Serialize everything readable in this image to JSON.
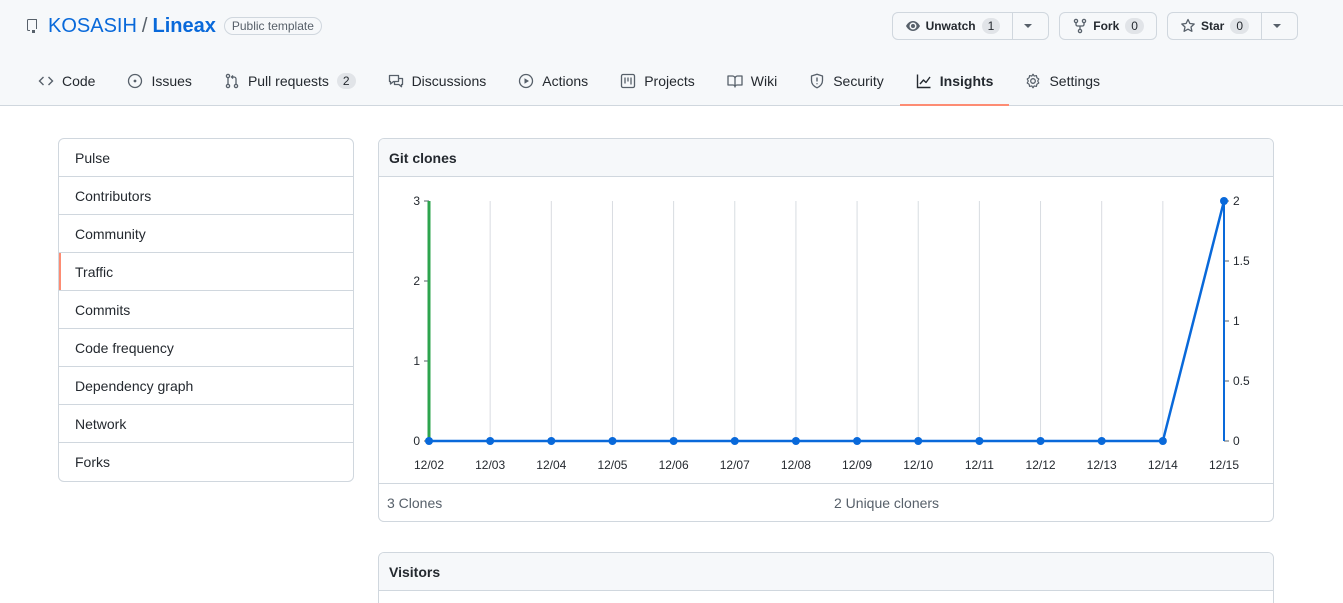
{
  "repo": {
    "owner": "KOSASIH",
    "separator": "/",
    "name": "Lineax",
    "visibility": "Public template"
  },
  "actions": {
    "watch": {
      "label": "Unwatch",
      "count": "1"
    },
    "fork": {
      "label": "Fork",
      "count": "0"
    },
    "star": {
      "label": "Star",
      "count": "0"
    }
  },
  "tabs": [
    {
      "label": "Code",
      "icon": "code-icon"
    },
    {
      "label": "Issues",
      "icon": "issue-icon"
    },
    {
      "label": "Pull requests",
      "icon": "pull-request-icon",
      "count": "2"
    },
    {
      "label": "Discussions",
      "icon": "discussion-icon"
    },
    {
      "label": "Actions",
      "icon": "play-icon"
    },
    {
      "label": "Projects",
      "icon": "project-icon"
    },
    {
      "label": "Wiki",
      "icon": "book-icon"
    },
    {
      "label": "Security",
      "icon": "shield-icon"
    },
    {
      "label": "Insights",
      "icon": "graph-icon",
      "active": true
    },
    {
      "label": "Settings",
      "icon": "gear-icon"
    }
  ],
  "menu": [
    {
      "label": "Pulse"
    },
    {
      "label": "Contributors"
    },
    {
      "label": "Community"
    },
    {
      "label": "Traffic",
      "selected": true
    },
    {
      "label": "Commits"
    },
    {
      "label": "Code frequency"
    },
    {
      "label": "Dependency graph"
    },
    {
      "label": "Network"
    },
    {
      "label": "Forks"
    }
  ],
  "clones": {
    "title": "Git clones",
    "total_label": "3 Clones",
    "unique_label": "2 Unique cloners"
  },
  "visitors": {
    "title": "Visitors"
  },
  "colors": {
    "accent": "#fd8c73",
    "link": "#0969da",
    "clones_series": "#2da44e",
    "unique_series": "#0969da"
  },
  "chart_data": {
    "type": "line",
    "categories": [
      "12/02",
      "12/03",
      "12/04",
      "12/05",
      "12/06",
      "12/07",
      "12/08",
      "12/09",
      "12/10",
      "12/11",
      "12/12",
      "12/13",
      "12/14",
      "12/15"
    ],
    "series": [
      {
        "values": [
          3,
          0,
          0,
          0,
          0,
          0,
          0,
          0,
          0,
          0,
          0,
          0,
          0,
          0
        ],
        "style": "bar",
        "color": "#2da44e",
        "axis": "left"
      },
      {
        "values": [
          0,
          0,
          0,
          0,
          0,
          0,
          0,
          0,
          0,
          0,
          0,
          0,
          0,
          2
        ],
        "style": "line",
        "color": "#0969da",
        "axis": "right"
      }
    ],
    "y_left": {
      "ticks": [
        "0",
        "1",
        "2",
        "3"
      ],
      "range": [
        0,
        3
      ]
    },
    "y_right": {
      "ticks": [
        "0",
        "0.5",
        "1",
        "1.5",
        "2"
      ],
      "range": [
        0,
        2
      ]
    },
    "grid": true
  }
}
